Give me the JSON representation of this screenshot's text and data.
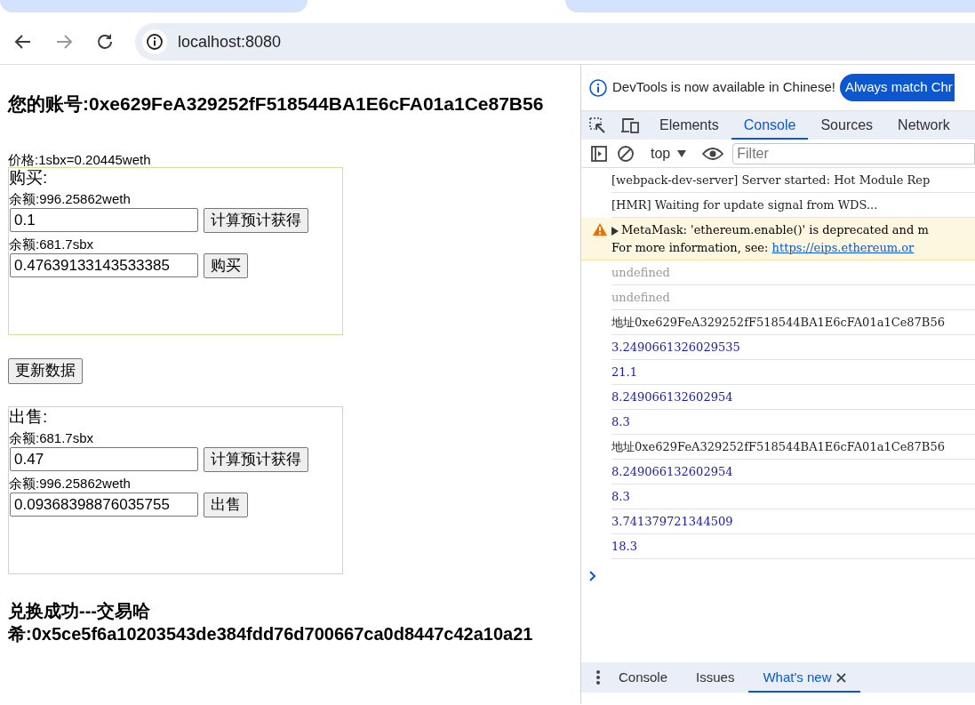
{
  "browser": {
    "address": "localhost:8080"
  },
  "page": {
    "account": "您的账号:0xe629FeA329252fF518544BA1E6cFA01a1Ce87B56",
    "price": "价格:1sbx=0.20445weth",
    "panels": [
      {
        "title": "购买:",
        "rows": [
          {
            "balance": "余额:996.25862weth",
            "value": "0.1",
            "button": "计算预计获得"
          },
          {
            "balance": "余额:681.7sbx",
            "value": "0.47639133143533385",
            "button": "购买"
          }
        ]
      },
      {
        "title": "出售:",
        "rows": [
          {
            "balance": "余额:681.7sbx",
            "value": "0.47",
            "button": "计算预计获得"
          },
          {
            "balance": "余额:996.25862weth",
            "value": "0.09368398876035755",
            "button": "出售"
          }
        ]
      }
    ],
    "refresh_button": "更新数据",
    "result": "兑换成功---交易哈希:0x5ce5f6a10203543de384fdd76d700667ca0d8447c42a10a21"
  },
  "devtools": {
    "notice": "DevTools is now available in Chinese!",
    "notice_button": "Always match Chr",
    "tabs": [
      {
        "label": "Elements",
        "selected": false
      },
      {
        "label": "Console",
        "selected": true
      },
      {
        "label": "Sources",
        "selected": false
      },
      {
        "label": "Network",
        "selected": false
      }
    ],
    "context": "top",
    "filter_placeholder": "Filter",
    "messages": [
      {
        "kind": "log",
        "text": "[webpack-dev-server] Server started: Hot Module Rep"
      },
      {
        "kind": "log",
        "text": "[HMR] Waiting for update signal from WDS..."
      },
      {
        "kind": "warning",
        "text": "MetaMask: 'ethereum.enable()' is deprecated and m",
        "text2": "For more information, see: ",
        "link": "https://eips.ethereum.or"
      },
      {
        "kind": "result",
        "text": "undefined"
      },
      {
        "kind": "result",
        "text": "undefined"
      },
      {
        "kind": "log",
        "text": "地址0xe629FeA329252fF518544BA1E6cFA01a1Ce87B56"
      },
      {
        "kind": "number",
        "text": "3.2490661326029535"
      },
      {
        "kind": "number",
        "text": "21.1"
      },
      {
        "kind": "number",
        "text": "8.249066132602954"
      },
      {
        "kind": "number",
        "text": "8.3"
      },
      {
        "kind": "log",
        "text": "地址0xe629FeA329252fF518544BA1E6cFA01a1Ce87B56"
      },
      {
        "kind": "number",
        "text": "8.249066132602954"
      },
      {
        "kind": "number",
        "text": "8.3"
      },
      {
        "kind": "number",
        "text": "3.741379721344509"
      },
      {
        "kind": "number",
        "text": "18.3"
      }
    ],
    "drawer_tabs": [
      {
        "label": "Console",
        "selected": false,
        "closable": false
      },
      {
        "label": "Issues",
        "selected": false,
        "closable": false
      },
      {
        "label": "What's new",
        "selected": true,
        "closable": true
      }
    ]
  }
}
